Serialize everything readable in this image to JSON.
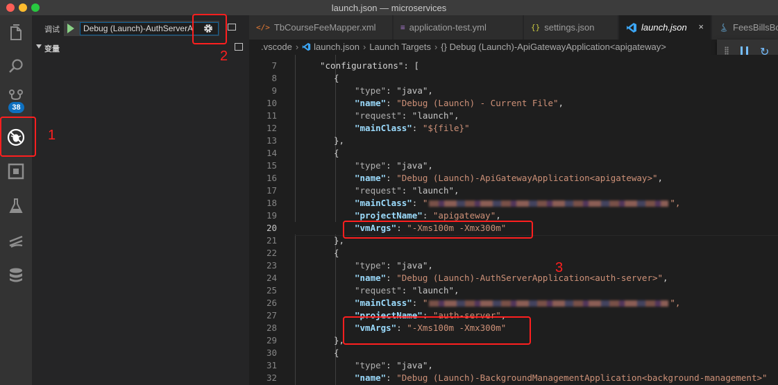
{
  "window": {
    "title": "launch.json — microservices"
  },
  "activity_bar": {
    "items": [
      {
        "name": "explorer",
        "icon": "files-icon"
      },
      {
        "name": "search",
        "icon": "search-icon"
      },
      {
        "name": "source-control",
        "icon": "git-icon",
        "badge": "38"
      },
      {
        "name": "debug",
        "icon": "debug-icon"
      },
      {
        "name": "extensions",
        "icon": "extensions-icon"
      },
      {
        "name": "test",
        "icon": "flask-icon"
      },
      {
        "name": "stack",
        "icon": "stack-icon"
      },
      {
        "name": "database",
        "icon": "database-icon"
      }
    ]
  },
  "sidebar": {
    "debug_title": "调试",
    "selected_config": "Debug (Launch)-AuthServerA",
    "variables_label": "变量"
  },
  "tabs": [
    {
      "label": "TbCourseFeeMapper.xml",
      "icon": "</>"
    },
    {
      "label": "application-test.yml",
      "icon": "≡"
    },
    {
      "label": "settings.json",
      "icon": "{}"
    },
    {
      "label": "launch.json",
      "icon": "vscode",
      "active": true,
      "close": "×"
    },
    {
      "label": "FeesBillsBo",
      "icon": "java"
    }
  ],
  "breadcrumb": [
    ".vscode",
    "launch.json",
    "Launch Targets",
    "{} Debug (Launch)-ApiGatewayApplication<apigateway>"
  ],
  "editor": {
    "current_line": 20,
    "lines": [
      {
        "n": "7",
        "text": "\"configurations\": ["
      },
      {
        "n": "8",
        "text": "{"
      },
      {
        "n": "9",
        "key": "\"type\"",
        "val": "\"java\""
      },
      {
        "n": "10",
        "key": "\"name\"",
        "val": "\"Debug (Launch) - Current File\""
      },
      {
        "n": "11",
        "key": "\"request\"",
        "val": "\"launch\""
      },
      {
        "n": "12",
        "key": "\"mainClass\"",
        "val": "\"${file}\""
      },
      {
        "n": "13",
        "text": "},"
      },
      {
        "n": "14",
        "text": "{"
      },
      {
        "n": "15",
        "key": "\"type\"",
        "val": "\"java\""
      },
      {
        "n": "16",
        "key": "\"name\"",
        "val": "\"Debug (Launch)-ApiGatewayApplication<apigateway>\""
      },
      {
        "n": "17",
        "key": "\"request\"",
        "val": "\"launch\""
      },
      {
        "n": "18",
        "key": "\"mainClass\"",
        "val": "\"",
        "tail": "\","
      },
      {
        "n": "19",
        "key": "\"projectName\"",
        "val": "\"apigateway\""
      },
      {
        "n": "20",
        "key": "\"vmArgs\"",
        "val": "\"-Xms100m -Xmx300m\""
      },
      {
        "n": "21",
        "text": "},"
      },
      {
        "n": "22",
        "text": "{"
      },
      {
        "n": "23",
        "key": "\"type\"",
        "val": "\"java\""
      },
      {
        "n": "24",
        "key": "\"name\"",
        "val": "\"Debug (Launch)-AuthServerApplication<auth-server>\""
      },
      {
        "n": "25",
        "key": "\"request\"",
        "val": "\"launch\""
      },
      {
        "n": "26",
        "key": "\"mainClass\"",
        "val": "\"",
        "tail": "\","
      },
      {
        "n": "27",
        "key": "\"projectName\"",
        "val": "\"auth-server\""
      },
      {
        "n": "28",
        "key": "\"vmArgs\"",
        "val": "\"-Xms100m -Xmx300m\""
      },
      {
        "n": "29",
        "text": "},"
      },
      {
        "n": "30",
        "text": "{"
      },
      {
        "n": "31",
        "key": "\"type\"",
        "val": "\"java\""
      },
      {
        "n": "32",
        "key": "\"name\"",
        "val": "\"Debug (Launch)-BackgroundManagementApplication<background-management>\""
      }
    ]
  },
  "annotations": {
    "label1": "1",
    "label2": "2",
    "label3": "3",
    "color": "#ff1f1f"
  }
}
